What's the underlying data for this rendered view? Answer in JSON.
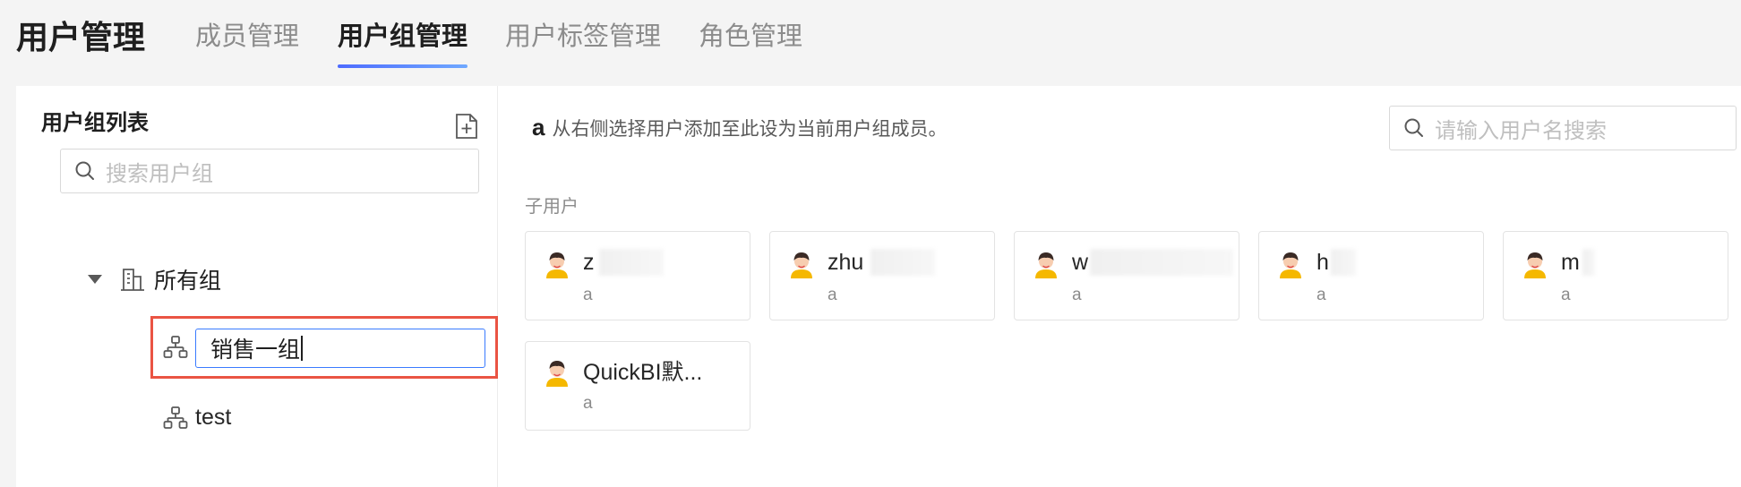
{
  "header": {
    "title": "用户管理",
    "tabs": [
      {
        "label": "成员管理",
        "active": false
      },
      {
        "label": "用户组管理",
        "active": true
      },
      {
        "label": "用户标签管理",
        "active": false
      },
      {
        "label": "角色管理",
        "active": false
      }
    ]
  },
  "left_panel": {
    "title": "用户组列表",
    "new_group_icon": "file-plus-icon",
    "search_placeholder": "搜索用户组",
    "tree": {
      "root_label": "所有组",
      "root_icon": "building-icon",
      "nodes": [
        {
          "label": "销售一组",
          "editing": true,
          "icon": "org-chart-icon"
        },
        {
          "label": "test",
          "editing": false,
          "icon": "org-chart-icon"
        }
      ]
    }
  },
  "right_panel": {
    "hint_bold": "a",
    "hint_text": "从右侧选择用户添加至此设为当前用户组成员。",
    "search_placeholder": "请输入用户名搜索",
    "section_title": "子用户",
    "users": [
      {
        "name": "z",
        "sub": "a"
      },
      {
        "name": "zhu",
        "sub": "a"
      },
      {
        "name": "w",
        "sub": "a"
      },
      {
        "name": "h",
        "sub": "a"
      },
      {
        "name": "m",
        "sub": "a"
      },
      {
        "name": "QuickBI默...",
        "sub": "a"
      }
    ]
  },
  "colors": {
    "accent": "#4d6bfe",
    "highlight_border": "#ea5443",
    "input_focus": "#3a7bff"
  }
}
